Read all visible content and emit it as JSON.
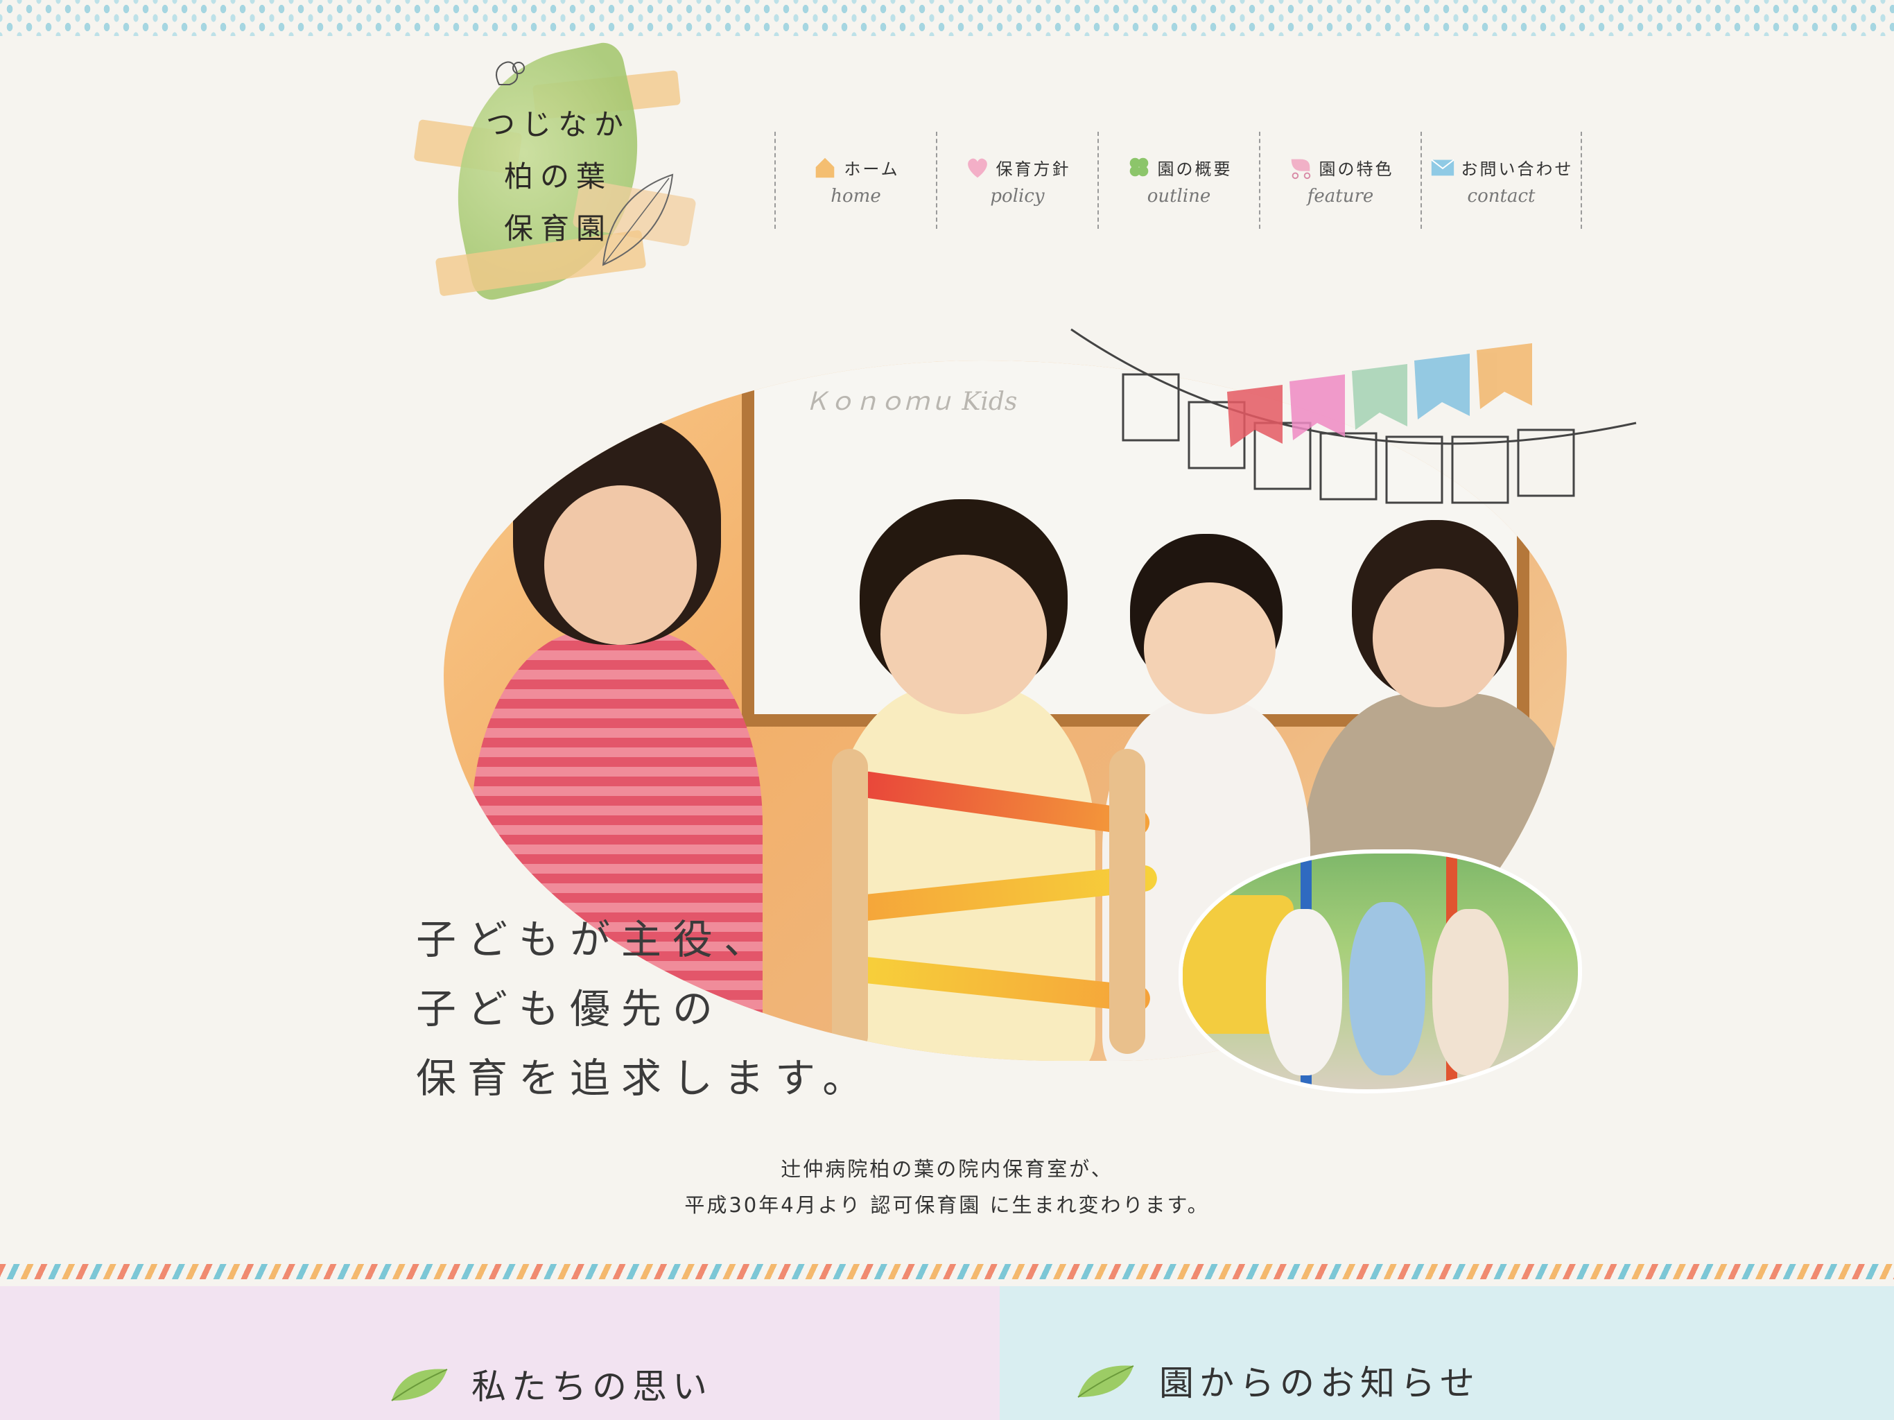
{
  "logo": {
    "lines": [
      "つじなか",
      "柏の葉",
      "保育園"
    ]
  },
  "nav": {
    "items": [
      {
        "jp": "ホーム",
        "en": "home",
        "icon": "house-icon",
        "color": "#f3b45a"
      },
      {
        "jp": "保育方針",
        "en": "policy",
        "icon": "heart-icon",
        "color": "#f2a2c0"
      },
      {
        "jp": "園の概要",
        "en": "outline",
        "icon": "clover-icon",
        "color": "#8cc56a"
      },
      {
        "jp": "園の特色",
        "en": "feature",
        "icon": "stroller-icon",
        "color": "#f0a5bf"
      },
      {
        "jp": "お問い合わせ",
        "en": "contact",
        "icon": "envelope-icon",
        "color": "#7cc2e3"
      }
    ]
  },
  "hero": {
    "board_text": "Ｋｏｎｏｍｕ Kids"
  },
  "tagline": {
    "line1": "子どもが主役、",
    "line2": "子ども優先の",
    "line3": "保育を追求します。"
  },
  "intro": {
    "line1": "辻仲病院柏の葉の院内保育室が、",
    "line2": "平成30年4月より 認可保育園 に生まれ変わります。"
  },
  "sections": {
    "left_title": "私たちの思い",
    "right_title": "園からのお知らせ"
  },
  "colors": {
    "background": "#f6f4ef",
    "left_panel": "#f2e3f1",
    "right_panel": "#d9eef1"
  }
}
